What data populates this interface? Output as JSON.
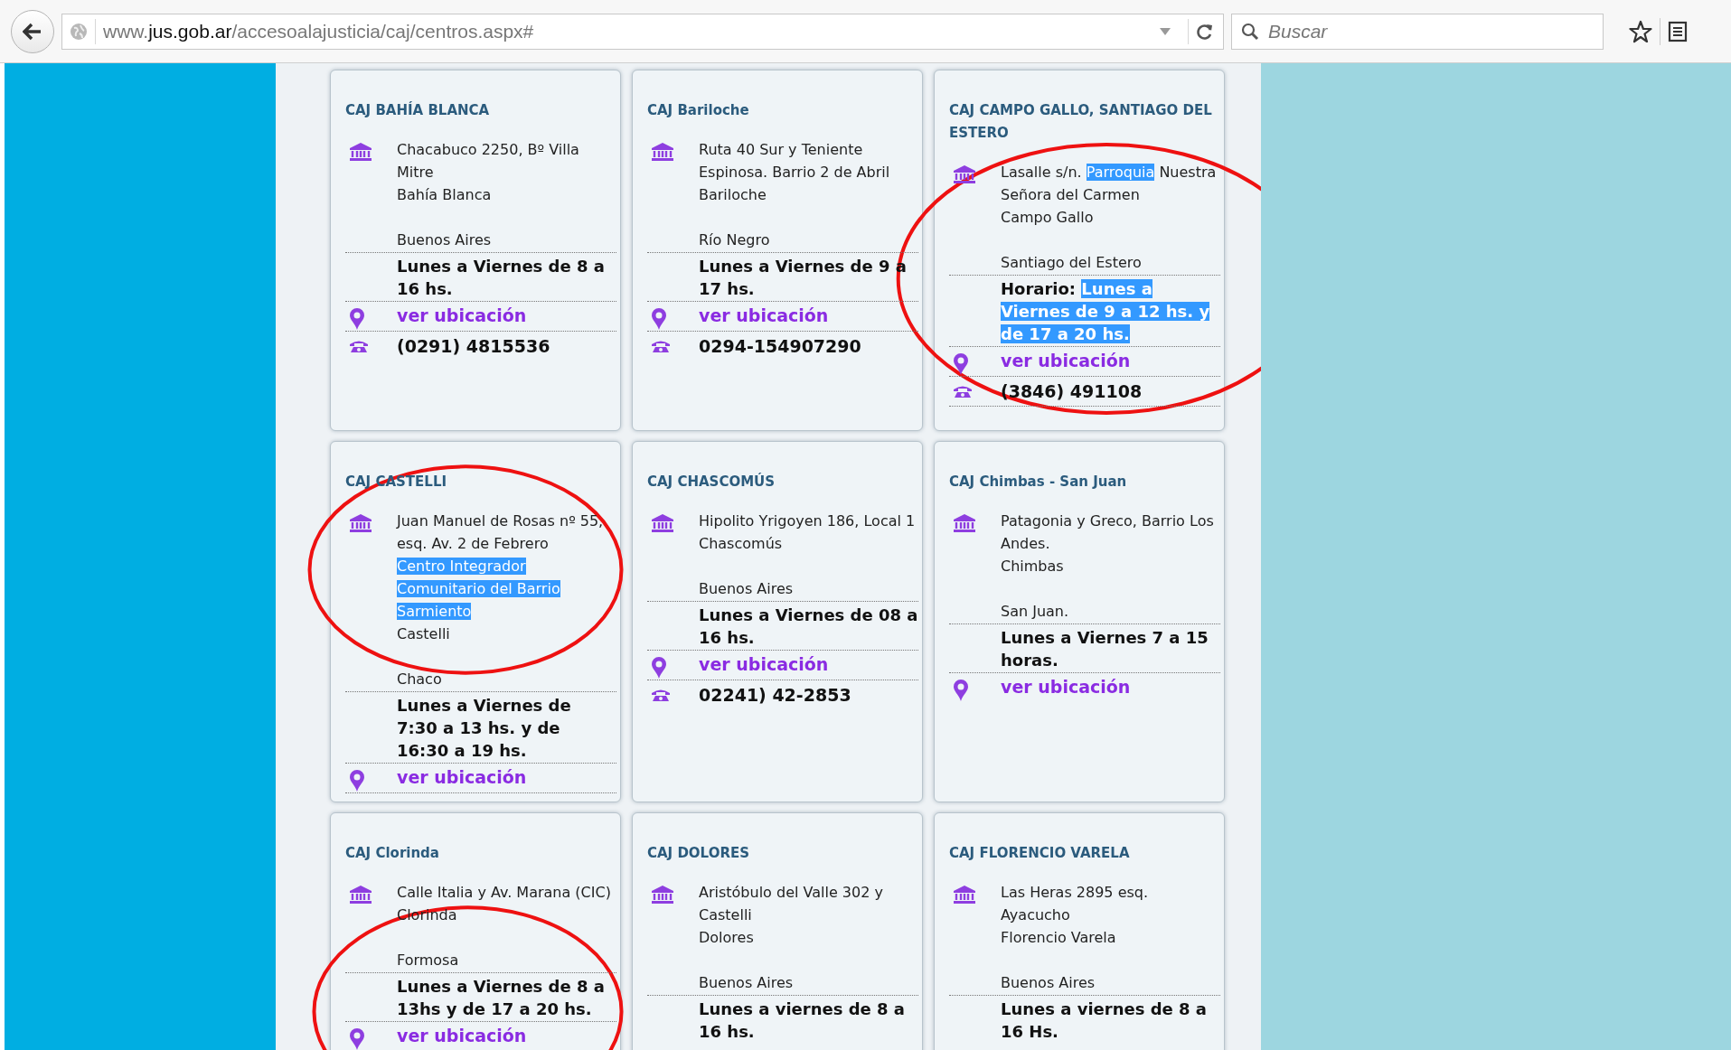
{
  "browser": {
    "url": [
      {
        "text": "www.",
        "strong": false
      },
      {
        "text": "jus.gob.ar",
        "strong": true
      },
      {
        "text": "/accesoalajusticia/caj/centros.aspx#",
        "strong": false
      }
    ],
    "search": {
      "placeholder": "Buscar"
    }
  },
  "centers": [
    {
      "title": "CAJ BAHÍA BLANCA",
      "address": [
        [
          {
            "text": "Chacabuco 2250, Bº Villa Mitre",
            "highlighted": false
          }
        ]
      ],
      "city": "Bahía Blanca",
      "province": "Buenos Aires",
      "schedule": [
        {
          "text": "Lunes a Viernes de 8 a 16 hs.",
          "highlighted": false
        }
      ],
      "location_link": "ver ubicación",
      "phone": "(0291) 4815536"
    },
    {
      "title": "CAJ Bariloche",
      "address": [
        [
          {
            "text": "Ruta 40 Sur y Teniente Espinosa. Barrio 2 de Abril",
            "highlighted": false
          }
        ]
      ],
      "city": "Bariloche",
      "province": "Río Negro",
      "schedule": [
        {
          "text": "Lunes a Viernes de 9 a 17 hs.",
          "highlighted": false
        }
      ],
      "location_link": "ver ubicación",
      "phone": "0294-154907290"
    },
    {
      "title": "CAJ CAMPO GALLO, SANTIAGO DEL ESTERO",
      "address": [
        [
          {
            "text": "Lasalle s/n. ",
            "highlighted": false
          },
          {
            "text": "Parroquia",
            "highlighted": true
          },
          {
            "text": " Nuestra Señora del Carmen",
            "highlighted": false
          }
        ]
      ],
      "city": "Campo Gallo",
      "province": "Santiago del Estero",
      "schedule": [
        {
          "text": "Horario: ",
          "highlighted": false
        },
        {
          "text": "Lunes a Viernes de 9 a 12 hs. y de 17 a 20 hs.",
          "highlighted": true
        }
      ],
      "location_link": "ver ubicación",
      "phone": "(3846) 491108",
      "circled": true
    },
    {
      "title": "CAJ CASTELLI",
      "address": [
        [
          {
            "text": "Juan Manuel de Rosas nº 55, esq. Av. 2 de Febrero",
            "highlighted": false
          }
        ],
        [
          {
            "text": "Centro Integrador Comunitario del Barrio Sarmiento",
            "highlighted": true
          }
        ]
      ],
      "city": "Castelli",
      "province": "Chaco",
      "schedule": [
        {
          "text": "Lunes a Viernes de 7:30 a 13 hs. y de 16:30 a 19 hs.",
          "highlighted": false
        }
      ],
      "location_link": "ver ubicación",
      "circled": true
    },
    {
      "title": "CAJ CHASCOMÚS",
      "address": [
        [
          {
            "text": "Hipolito Yrigoyen 186, Local 1",
            "highlighted": false
          }
        ]
      ],
      "city": "Chascomús",
      "province": "Buenos Aires",
      "schedule": [
        {
          "text": "Lunes a Viernes de 08 a 16 hs.",
          "highlighted": false
        }
      ],
      "location_link": "ver ubicación",
      "phone": "02241) 42-2853"
    },
    {
      "title": "CAJ Chimbas - San Juan",
      "address": [
        [
          {
            "text": "Patagonia y Greco, Barrio Los Andes.",
            "highlighted": false
          }
        ]
      ],
      "city": "Chimbas",
      "province": "San Juan.",
      "schedule": [
        {
          "text": "Lunes a Viernes 7 a 15 horas.",
          "highlighted": false
        }
      ],
      "location_link": "ver ubicación"
    },
    {
      "title": "CAJ Clorinda",
      "address": [
        [
          {
            "text": "Calle Italia y Av. Marana (CIC)",
            "highlighted": false
          }
        ]
      ],
      "city": "Clorinda",
      "province": "Formosa",
      "schedule": [
        {
          "text": "Lunes a Viernes de 8 a 13hs y de 17 a 20 hs.",
          "highlighted": false
        }
      ],
      "location_link": "ver ubicación",
      "circled": true
    },
    {
      "title": "CAJ DOLORES",
      "address": [
        [
          {
            "text": "Aristóbulo del Valle 302 y Castelli",
            "highlighted": false
          }
        ]
      ],
      "city": "Dolores",
      "province": "Buenos Aires",
      "schedule": [
        {
          "text": "Lunes a viernes de 8 a 16 hs.",
          "highlighted": false
        }
      ]
    },
    {
      "title": "CAJ FLORENCIO VARELA",
      "address": [
        [
          {
            "text": "Las Heras 2895 esq. Ayacucho",
            "highlighted": false
          }
        ]
      ],
      "city": "Florencio Varela",
      "province": "Buenos Aires",
      "schedule": [
        {
          "text": "Lunes a viernes de 8 a 16 Hs.",
          "highlighted": false
        }
      ]
    }
  ]
}
